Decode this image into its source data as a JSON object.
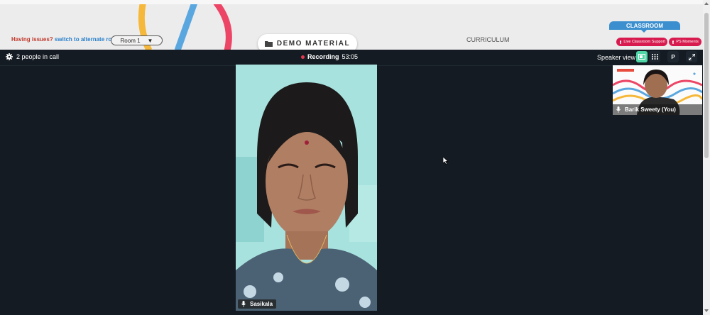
{
  "header": {
    "issues_text": "Having issues?",
    "switch_link": "switch to alternate room",
    "room_select": "Room 1",
    "demo_material": "DEMO MATERIAL",
    "curriculum": "CURRICULUM",
    "classroom_tab": "CLASSROOM",
    "live_support": "Live Classroom Support",
    "ps_moments": "PS Moments"
  },
  "call": {
    "people_count": "2 people in call",
    "recording_label": "Recording",
    "recording_time": "53:05",
    "view_mode": "Speaker view",
    "p_button": "P",
    "main_participant": "Sasikala",
    "self_participant": "Barik Sweety (You)"
  },
  "colors": {
    "brand_red": "#d81b4f",
    "accent_blue": "#3b8fcf",
    "active_green": "#4fd6a6",
    "call_bg": "#141b22"
  },
  "icons": [
    "gear-icon",
    "record-dot-icon",
    "speaker-view-icon",
    "grid-view-icon",
    "expand-icon",
    "mic-icon",
    "folder-icon",
    "chevron-down-icon"
  ]
}
